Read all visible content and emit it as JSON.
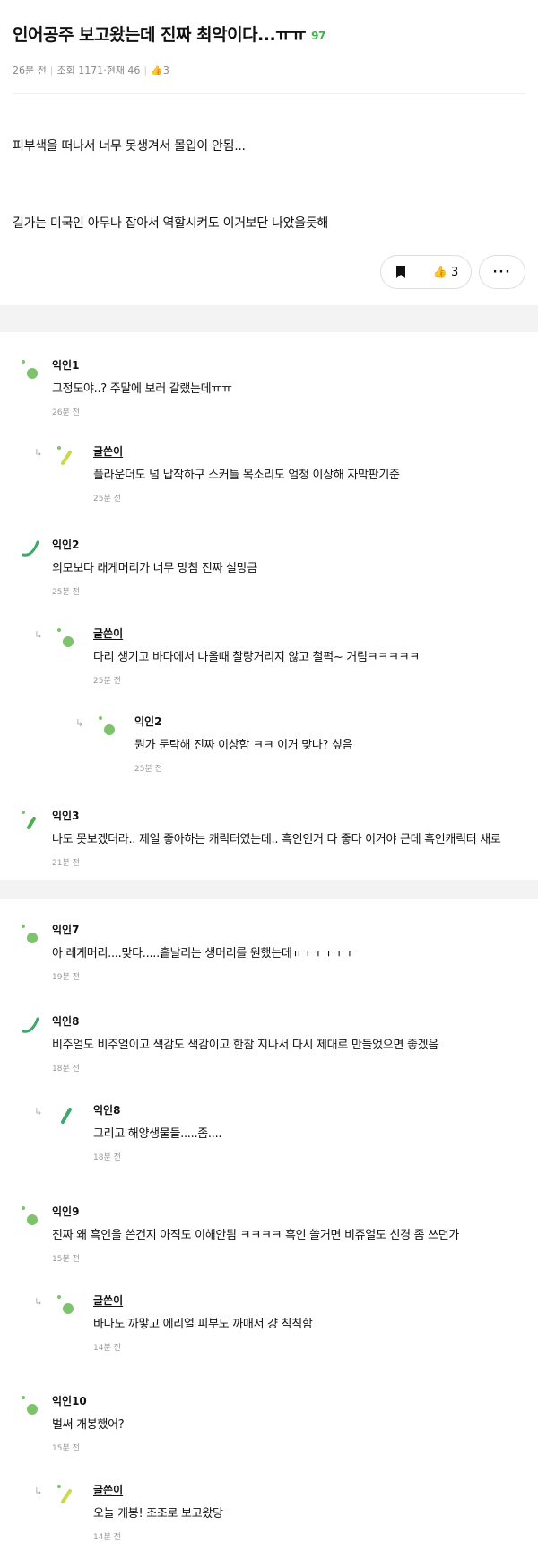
{
  "post": {
    "title": "인어공주 보고왔는데 진짜 최악이다...ㅠㅠ",
    "comment_count": "97",
    "time": "26분 전",
    "views": "조회 1171",
    "now": "현재 46",
    "likes": "3",
    "body": [
      "피부색을 떠나서 너무 못생겨서 몰입이 안됨...",
      "길가는 미국인 아무나 잡아서 역할시켜도 이거보단 나았을듯해"
    ],
    "like_count": "3",
    "more_label": "···"
  },
  "comments": [
    {
      "name": "익인1",
      "text": "그정도야..? 주말에 보러 갈랬는데ㅠㅠ",
      "time": "26분 전"
    },
    {
      "name": "글쓴이",
      "text": "플라운더도 넘 납작하구 스커틀 목소리도 엄청 이상해 자막판기준",
      "time": "25분 전"
    },
    {
      "name": "익인2",
      "text": "외모보다 래게머리가 너무 망침 진짜 실망큼",
      "time": "25분 전"
    },
    {
      "name": "글쓴이",
      "text": "다리 생기고 바다에서 나올때 찰랑거리지 않고 철퍽~ 거림ㅋㅋㅋㅋㅋ",
      "time": "25분 전"
    },
    {
      "name": "익인2",
      "text": "뭔가 둔탁해 진짜 이상함 ㅋㅋ 이거 맞나? 싶음",
      "time": "25분 전"
    },
    {
      "name": "익인3",
      "text": "나도 못보겠더라.. 제일 좋아하는 캐릭터였는데.. 흑인인거 다 좋다 이거야 근데 흑인캐릭터 새로",
      "time": "21분 전"
    },
    {
      "name": "익인7",
      "text": "아 레게머리....맞다.....흩날리는 생머리를 원했는데ㅠㅜㅜㅜㅜㅜ",
      "time": "19분 전"
    },
    {
      "name": "익인8",
      "text": "비주얼도 비주얼이고 색감도 색감이고 한참 지나서 다시 제대로 만들었으면 좋겠음",
      "time": "18분 전"
    },
    {
      "name": "익인8",
      "text": "그리고 해양생물들.....좀....",
      "time": "18분 전"
    },
    {
      "name": "익인9",
      "text": "진짜 왜 흑인을 쓴건지 아직도 이해안됨 ㅋㅋㅋㅋ 흑인 쓸거면 비쥬얼도 신경 좀 쓰던가",
      "time": "15분 전"
    },
    {
      "name": "글쓴이",
      "text": "바다도 까맣고 에리얼 피부도 까매서 걍 칙칙함",
      "time": "14분 전"
    },
    {
      "name": "익인10",
      "text": "벌써 개봉했어?",
      "time": "15분 전"
    },
    {
      "name": "글쓴이",
      "text": "오늘 개봉! 조조로 보고왔당",
      "time": "14분 전"
    }
  ],
  "colors": {
    "accent_green": "#3bb54a",
    "muted": "#999999",
    "band": "#f3f3f3"
  }
}
